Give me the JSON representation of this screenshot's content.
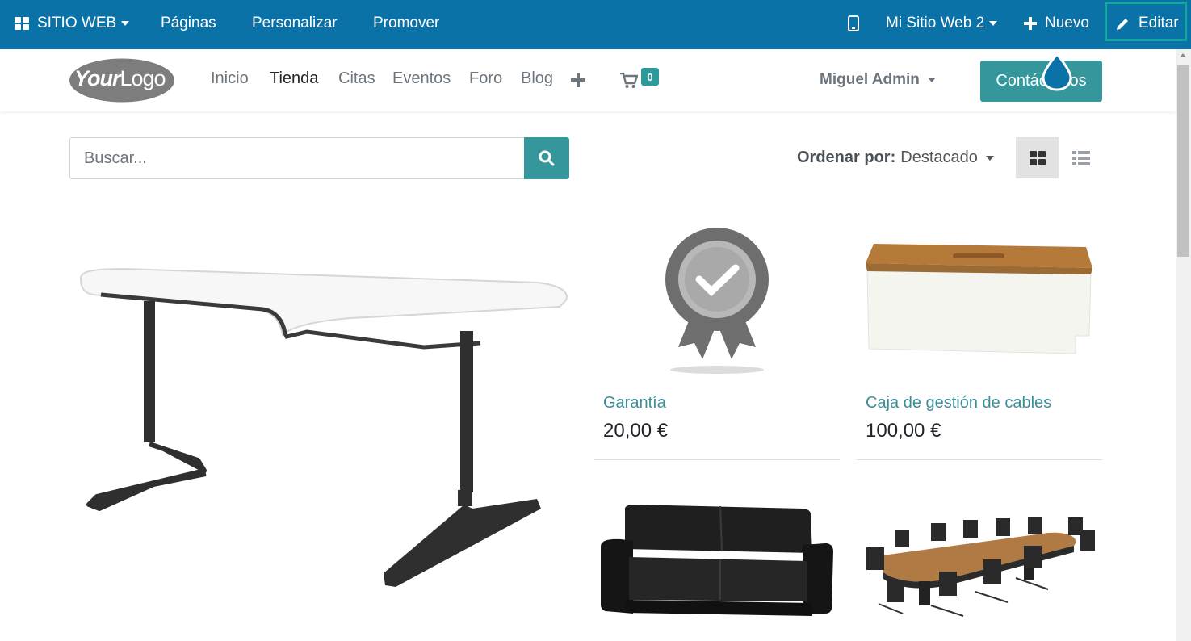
{
  "admin_bar": {
    "website_menu": "SITIO WEB",
    "pages": "Páginas",
    "customize": "Personalizar",
    "promote": "Promover",
    "site_selector": "Mi Sitio Web 2",
    "new": "Nuevo",
    "edit": "Editar"
  },
  "header": {
    "logo_text_bold": "Your",
    "logo_text_light": "Logo",
    "nav": [
      "Inicio",
      "Tienda",
      "Citas",
      "Eventos",
      "Foro",
      "Blog"
    ],
    "active_nav": "Tienda",
    "cart_count": "0",
    "user": "Miguel Admin",
    "contact_button": "Contáctenos"
  },
  "shop": {
    "search_placeholder": "Buscar...",
    "sort_label": "Ordenar por:",
    "sort_value": "Destacado",
    "products": [
      {
        "name": "",
        "price": "",
        "image": "corner-desk"
      },
      {
        "name": "Garantía",
        "price": "20,00 €",
        "image": "warranty-badge"
      },
      {
        "name": "Caja de gestión de cables",
        "price": "100,00 €",
        "image": "cable-box"
      },
      {
        "name": "",
        "price": "",
        "image": "black-sofa"
      },
      {
        "name": "",
        "price": "",
        "image": "conference-table"
      }
    ]
  },
  "colors": {
    "admin_bar": "#0b72a8",
    "accent": "#35979c",
    "edit_highlight": "#14a6a0",
    "product_link": "#3a8f9b"
  }
}
